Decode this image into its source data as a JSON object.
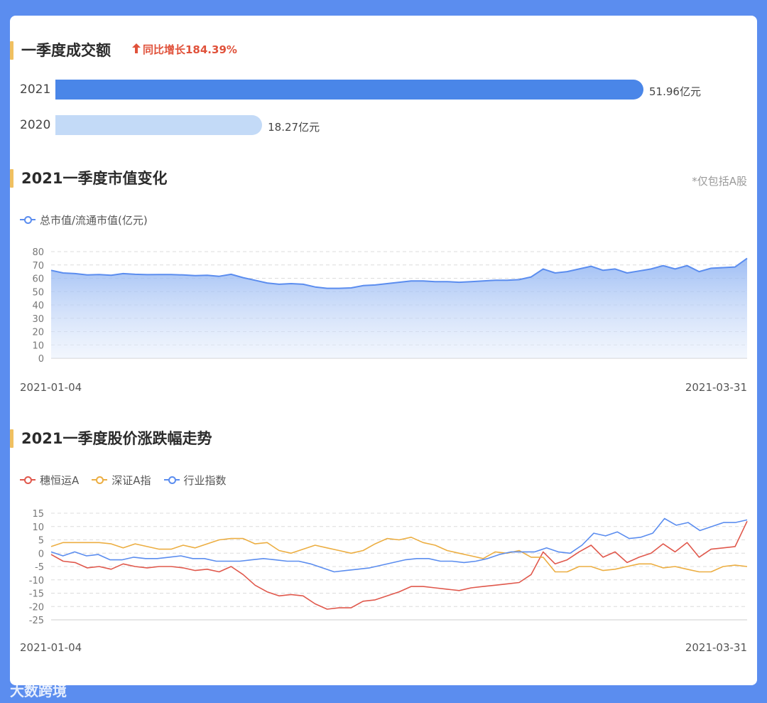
{
  "section1": {
    "title": "一季度成交额",
    "growth_text": "同比增长184.39%",
    "bars": [
      {
        "year": "2021",
        "value": 51.96,
        "label": "51.96亿元",
        "color": "#4a86e8"
      },
      {
        "year": "2020",
        "value": 18.27,
        "label": "18.27亿元",
        "color": "#c3daf7"
      }
    ]
  },
  "section2": {
    "title": "2021一季度市值变化",
    "note": "*仅包括A股",
    "legend": "总市值/流通市值(亿元)",
    "start_date": "2021-01-04",
    "end_date": "2021-03-31"
  },
  "section3": {
    "title": "2021一季度股价涨跌幅走势",
    "legend": [
      "穗恒运A",
      "深证A指",
      "行业指数"
    ],
    "start_date": "2021-01-04",
    "end_date": "2021-03-31"
  },
  "watermark": "大数跨境",
  "chart_data": [
    {
      "type": "bar",
      "title": "一季度成交额",
      "orientation": "horizontal",
      "categories": [
        "2021",
        "2020"
      ],
      "values": [
        51.96,
        18.27
      ],
      "unit": "亿元"
    },
    {
      "type": "area",
      "title": "2021一季度市值变化",
      "ylim": [
        0,
        80
      ],
      "yticks": [
        0,
        10,
        20,
        30,
        40,
        50,
        60,
        70,
        80
      ],
      "x_start": "2021-01-04",
      "x_end": "2021-03-31",
      "color": "#5b8def",
      "series": [
        {
          "name": "总市值/流通市值(亿元)",
          "values": [
            66,
            64,
            63.5,
            62.5,
            62.8,
            62.3,
            63.5,
            63,
            62.7,
            62.8,
            62.8,
            62.5,
            62,
            62.3,
            61.5,
            63,
            60.5,
            58.5,
            56.5,
            55.5,
            56,
            55.5,
            53.5,
            52.5,
            52.5,
            52.8,
            54.5,
            55,
            56,
            57,
            58,
            58,
            57.5,
            57.5,
            57,
            57.5,
            58,
            58.5,
            58.5,
            59,
            61,
            67,
            64,
            65,
            67,
            69,
            66,
            67,
            64,
            65.5,
            67,
            69.5,
            67,
            69.5,
            65,
            67.5,
            68,
            68.5,
            75
          ]
        }
      ]
    },
    {
      "type": "line",
      "title": "2021一季度股价涨跌幅走势",
      "ylim": [
        -25,
        15
      ],
      "yticks": [
        -25,
        -20,
        -15,
        -10,
        -5,
        0,
        5,
        10,
        15
      ],
      "x_start": "2021-01-04",
      "x_end": "2021-03-31",
      "series": [
        {
          "name": "穗恒运A",
          "color": "#e0584c",
          "values": [
            -0.5,
            -3,
            -3.5,
            -5.5,
            -5,
            -6,
            -4,
            -5,
            -5.5,
            -5,
            -5,
            -5.5,
            -6.5,
            -6,
            -7,
            -5,
            -8,
            -12,
            -14.5,
            -16,
            -15.5,
            -16,
            -19,
            -21,
            -20.5,
            -20.5,
            -18,
            -17.5,
            -16,
            -14.5,
            -12.5,
            -12.5,
            -13,
            -13.5,
            -14,
            -13,
            -12.5,
            -12,
            -11.5,
            -11,
            -8,
            0.5,
            -4,
            -2.5,
            0.5,
            3,
            -1.5,
            0.5,
            -3.5,
            -1.5,
            0,
            3.5,
            0.5,
            4,
            -1.5,
            1.5,
            2,
            2.5,
            12
          ]
        },
        {
          "name": "深证A指",
          "color": "#ecae42",
          "values": [
            2.5,
            4,
            4,
            4,
            4,
            3.5,
            2,
            3.5,
            2.5,
            1.5,
            1.5,
            3,
            2,
            3.5,
            5,
            5.5,
            5.5,
            3.5,
            4,
            1,
            0,
            1.5,
            3,
            2,
            1,
            0,
            1,
            3.5,
            5.5,
            5,
            6,
            4,
            3,
            1,
            0,
            -1,
            -2,
            0.5,
            0,
            1,
            -1.5,
            -1.5,
            -7,
            -7,
            -5,
            -5,
            -6.5,
            -6,
            -5,
            -4,
            -4,
            -5.5,
            -5,
            -6,
            -7,
            -7,
            -5,
            -4.5,
            -5
          ]
        },
        {
          "name": "行业指数",
          "color": "#5b8def",
          "values": [
            0.5,
            -1,
            0.5,
            -1,
            -0.5,
            -2.5,
            -2.5,
            -1.5,
            -2,
            -2,
            -1.5,
            -1,
            -2,
            -2,
            -3,
            -3,
            -3,
            -2.5,
            -2,
            -2.5,
            -3,
            -3,
            -4,
            -5.5,
            -7,
            -6.5,
            -6,
            -5.5,
            -4.5,
            -3.5,
            -2.5,
            -2,
            -2,
            -3,
            -3,
            -3.5,
            -3,
            -2,
            -0.5,
            0.5,
            0.5,
            0.5,
            2,
            0.5,
            0,
            3,
            7.5,
            6.5,
            8,
            5.5,
            6,
            7.5,
            13,
            10.5,
            11.5,
            8.5,
            10,
            11.5,
            11.5,
            12.5
          ]
        }
      ]
    }
  ]
}
